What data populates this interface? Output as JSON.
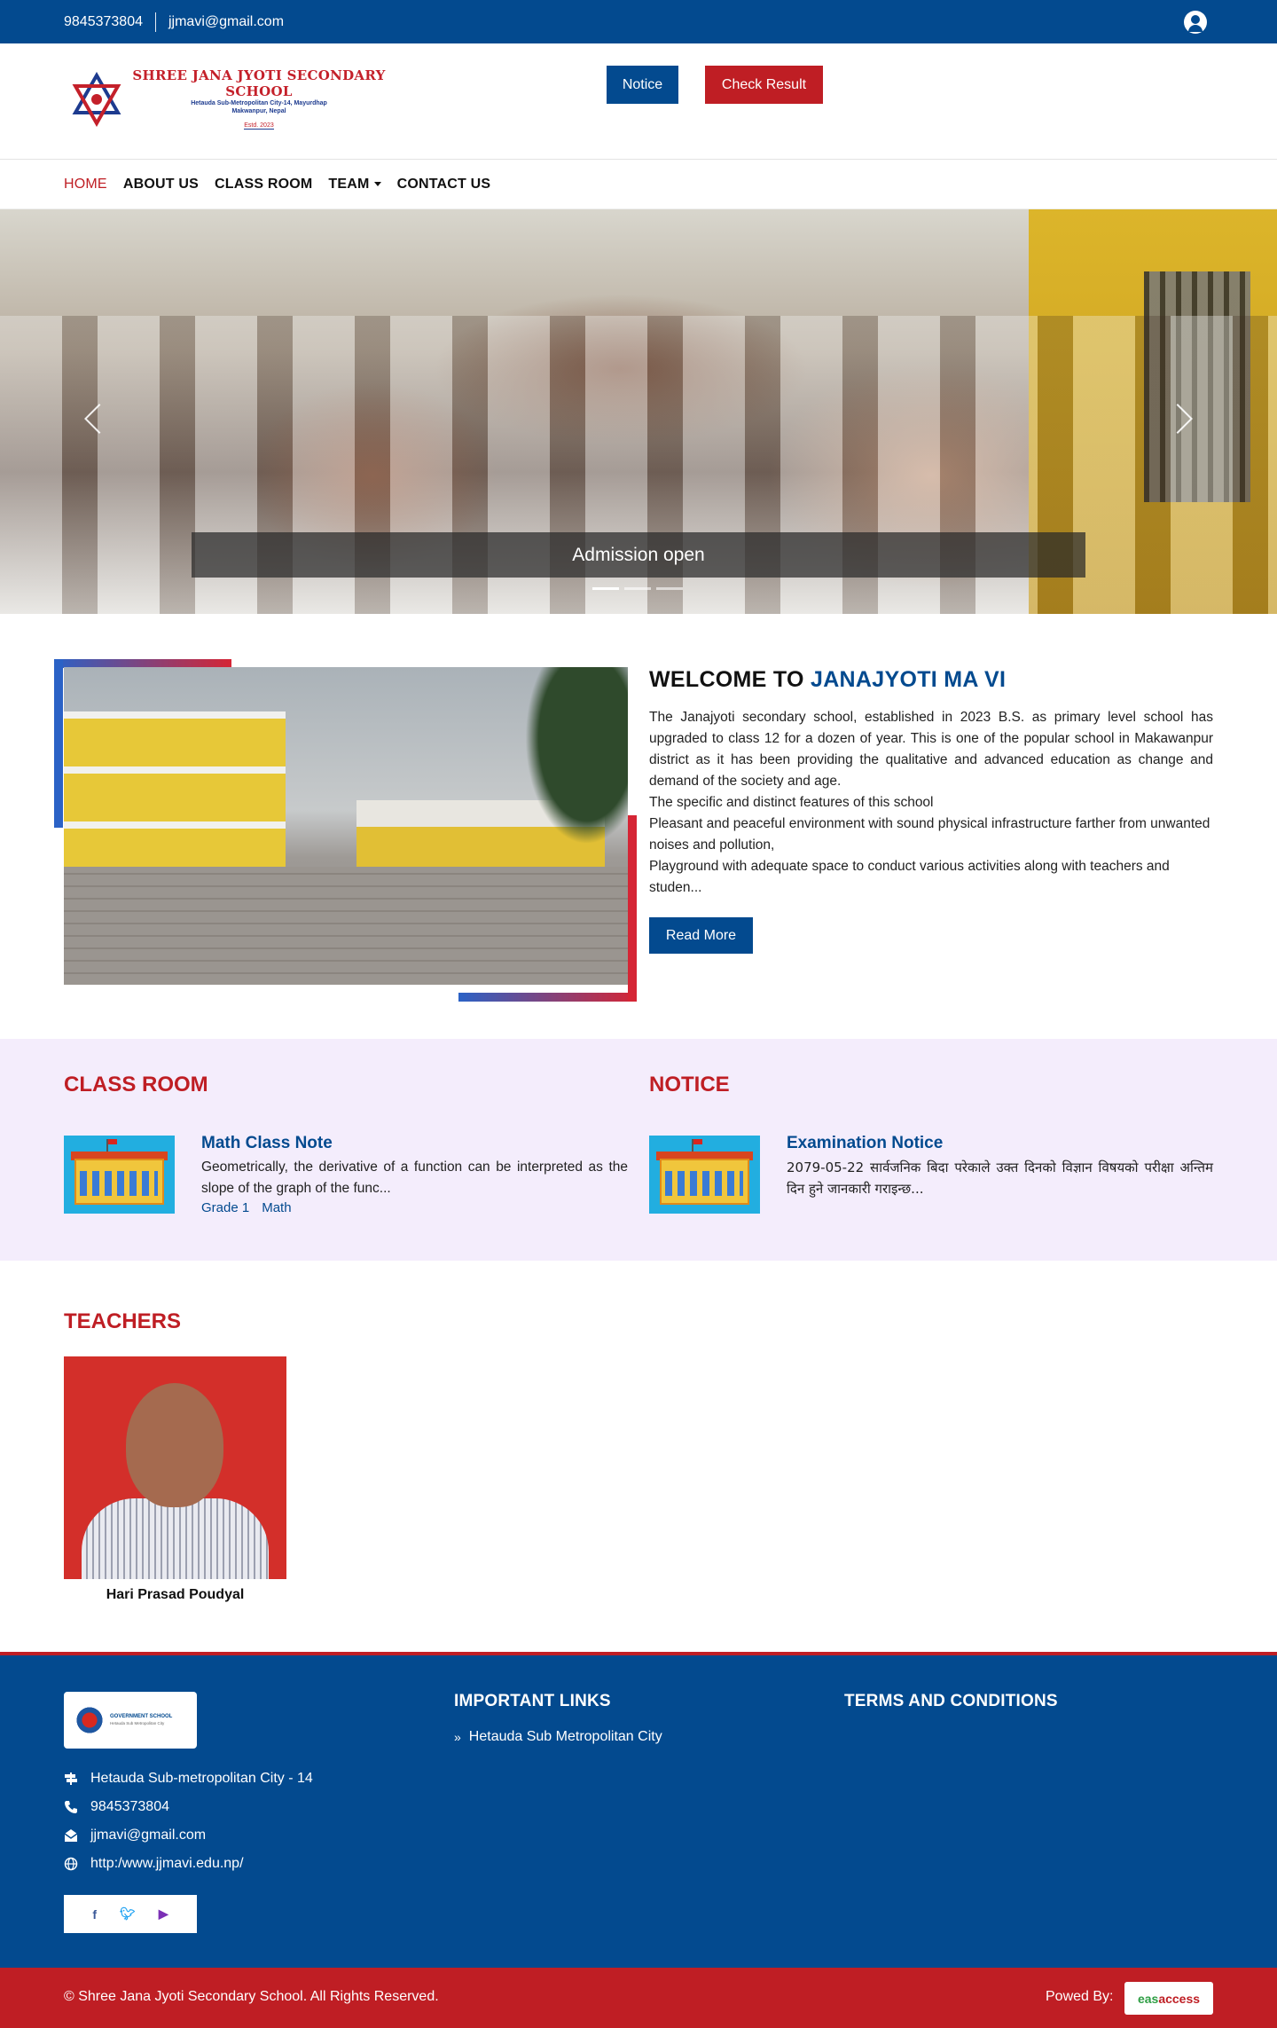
{
  "topbar": {
    "phone": "9845373804",
    "email": "jjmavi@gmail.com"
  },
  "logo": {
    "title": "SHREE JANA JYOTI SECONDARY SCHOOL",
    "line1": "Hetauda Sub-Metropolitan City-14, Mayurdhap",
    "line2": "Makwanpur, Nepal",
    "est": "Estd. 2023"
  },
  "header": {
    "notice_label": "Notice",
    "result_label": "Check Result"
  },
  "nav": {
    "home": "HOME",
    "about": "ABOUT US",
    "classroom": "CLASS ROOM",
    "team": "TEAM",
    "contact": "CONTACT US"
  },
  "hero": {
    "caption": "Admission open",
    "slides": 3,
    "active_slide": 1
  },
  "welcome": {
    "title_prefix": "WELCOME TO ",
    "title_highlight": "JANAJYOTI MA VI",
    "para1": "The Janajyoti secondary school, established in 2023 B.S. as primary level school has upgraded to class 12 for a dozen of year. This is one of the popular school in Makawanpur district as it has been providing the qualitative and advanced education as change and demand of the society and age.",
    "para2": "The specific and distinct features of this school",
    "para3": "Pleasant and peaceful environment with sound physical infrastructure farther from unwanted noises and pollution,",
    "para4": "Playground with adequate space to  conduct various activities along with teachers and studen...",
    "read_more": "Read More"
  },
  "classroom": {
    "heading": "CLASS ROOM",
    "item_title": "Math Class Note",
    "item_text": "Geometrically, the derivative of a function can be interpreted as the slope of the graph of the func...",
    "tags": [
      "Grade 1",
      "Math"
    ]
  },
  "notice": {
    "heading": "NOTICE",
    "item_title": "Examination Notice",
    "item_text": "2079-05-22 सार्वजनिक बिदा परेकाले उक्त दिनको विज्ञान विषयको परीक्षा अन्तिम दिन हुने जानकारी गराइन्छ..."
  },
  "teachers": {
    "heading": "TEACHERS",
    "name": "Hari Prasad Poudyal"
  },
  "footer": {
    "logo_title": "GOVERNMENT SCHOOL",
    "logo_sub": "Hetauda Sub Metropolitan City",
    "address": "Hetauda Sub-metropolitan City - 14",
    "phone": "9845373804",
    "email": "jjmavi@gmail.com",
    "website": "http:/www.jjmavi.edu.np/",
    "links_heading": "IMPORTANT LINKS",
    "link1": "Hetauda Sub Metropolitan City",
    "terms_heading": "TERMS AND CONDITIONS",
    "copyright": "© Shree Jana Jyoti Secondary School. All Rights Reserved.",
    "powered": "Powed By:",
    "easy_a": "eas",
    "easy_b": "access"
  },
  "colors": {
    "primary": "#034a8f",
    "accent": "#bf1e24",
    "panel_bg": "#f4edfc"
  },
  "icons": [
    "user-icon",
    "facebook-icon",
    "twitter-icon",
    "youtube-icon",
    "map-sign-icon",
    "phone-icon",
    "envelope-icon",
    "globe-icon"
  ]
}
